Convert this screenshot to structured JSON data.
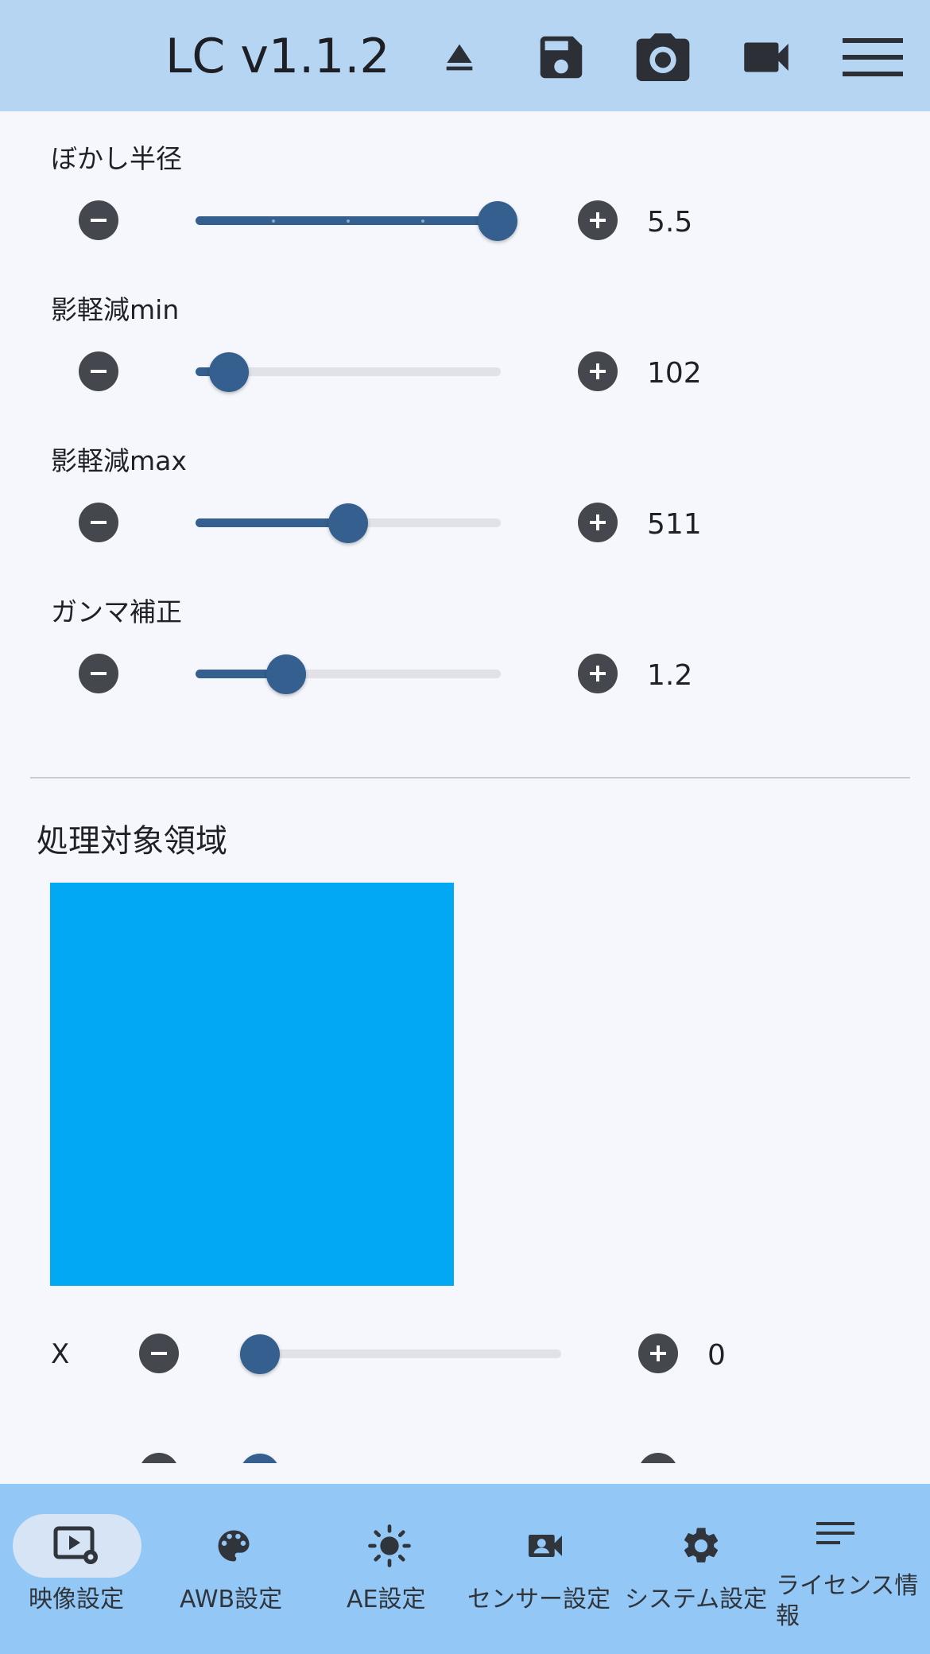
{
  "header": {
    "title": "LC v1.1.2",
    "icons": [
      "eject-icon",
      "save-icon",
      "camera-icon",
      "video-camera-icon",
      "menu-icon"
    ]
  },
  "sliders": [
    {
      "label": "ぼかし半径",
      "value": "5.5",
      "fraction": 1.0,
      "ticks": true
    },
    {
      "label": "影軽減min",
      "value": "102",
      "fraction": 0.1
    },
    {
      "label": "影軽減max",
      "value": "511",
      "fraction": 0.5
    },
    {
      "label": "ガンマ補正",
      "value": "1.2",
      "fraction": 0.3
    }
  ],
  "region": {
    "title": "処理対象領域",
    "color": "#02a8f3",
    "x_label": "X",
    "x_value": "0"
  },
  "bottom_nav": {
    "items": [
      {
        "label": "映像設定",
        "icon": "video-settings-icon",
        "active": true
      },
      {
        "label": "AWB設定",
        "icon": "palette-icon"
      },
      {
        "label": "AE設定",
        "icon": "brightness-icon"
      },
      {
        "label": "センサー設定",
        "icon": "video-account-icon"
      },
      {
        "label": "システム設定",
        "icon": "gear-icon"
      },
      {
        "label": "ライセンス情報",
        "icon": "notes-icon"
      }
    ]
  },
  "colors": {
    "header_bg": "#b5d5f3",
    "nav_bg": "#93c7f5",
    "accent": "#355f8e",
    "button": "#44474e"
  }
}
